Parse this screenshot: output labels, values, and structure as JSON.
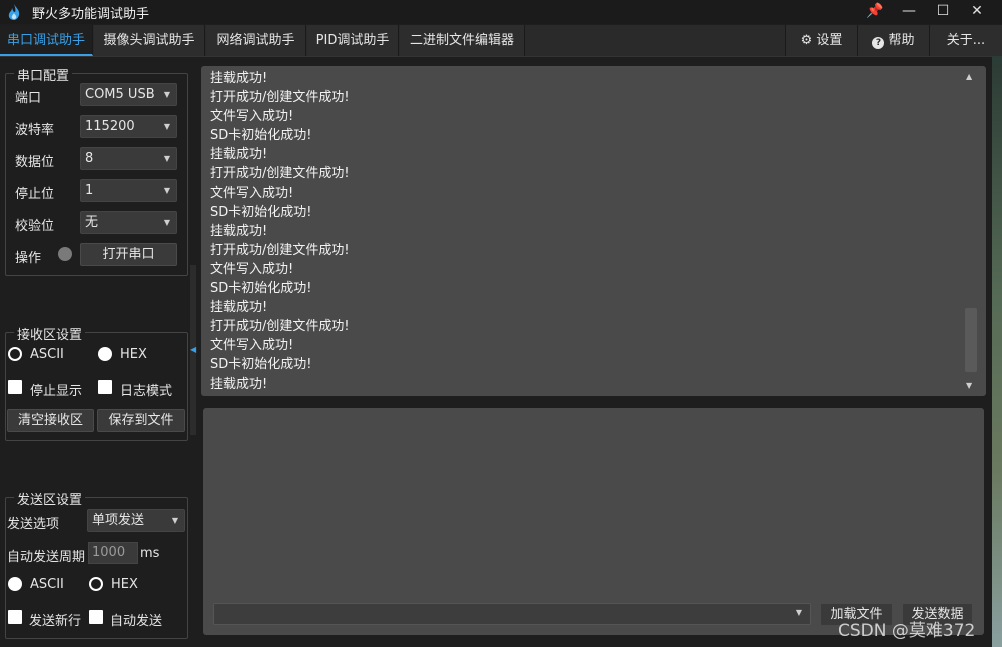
{
  "app": {
    "title": "野火多功能调试助手"
  },
  "window_controls": {
    "pin": "📌",
    "minimize": "—",
    "maximize": "☐",
    "close": "✕"
  },
  "tabs": [
    {
      "label": "串口调试助手",
      "active": true
    },
    {
      "label": "摄像头调试助手",
      "active": false
    },
    {
      "label": "网络调试助手",
      "active": false
    },
    {
      "label": "PID调试助手",
      "active": false
    },
    {
      "label": "二进制文件编辑器",
      "active": false
    }
  ],
  "right_tabs": {
    "settings": "设置",
    "help": "帮助",
    "about": "关于..."
  },
  "serial_config": {
    "title": "串口配置",
    "port_label": "端口",
    "port_value": "COM5 USB",
    "baud_label": "波特率",
    "baud_value": "115200",
    "databits_label": "数据位",
    "databits_value": "8",
    "stopbits_label": "停止位",
    "stopbits_value": "1",
    "parity_label": "校验位",
    "parity_value": "无",
    "op_label": "操作",
    "open_button": "打开串口"
  },
  "receive_settings": {
    "title": "接收区设置",
    "ascii": "ASCII",
    "hex": "HEX",
    "stop_display": "停止显示",
    "log_mode": "日志模式",
    "clear_button": "清空接收区",
    "save_button": "保存到文件"
  },
  "send_settings": {
    "title": "发送区设置",
    "option_label": "发送选项",
    "option_value": "单项发送",
    "period_label": "自动发送周期",
    "period_value": "1000",
    "period_unit": "ms",
    "ascii": "ASCII",
    "hex": "HEX",
    "newline": "发送新行",
    "auto_send": "自动发送"
  },
  "receive_lines": [
    "挂载成功!",
    "打开成功/创建文件成功!",
    "文件写入成功!",
    "SD卡初始化成功!",
    "挂载成功!",
    "打开成功/创建文件成功!",
    "文件写入成功!",
    "SD卡初始化成功!",
    "挂载成功!",
    "打开成功/创建文件成功!",
    "文件写入成功!",
    "SD卡初始化成功!",
    "挂载成功!",
    "打开成功/创建文件成功!",
    "文件写入成功!",
    "SD卡初始化成功!",
    "挂载成功!"
  ],
  "send_area": {
    "load_button": "加载文件",
    "send_button": "发送数据"
  },
  "watermark": "CSDN @莫难372",
  "colors": {
    "accent": "#3aa0e6",
    "background": "#1e1e1e",
    "text_area": "#4a4a4a"
  }
}
